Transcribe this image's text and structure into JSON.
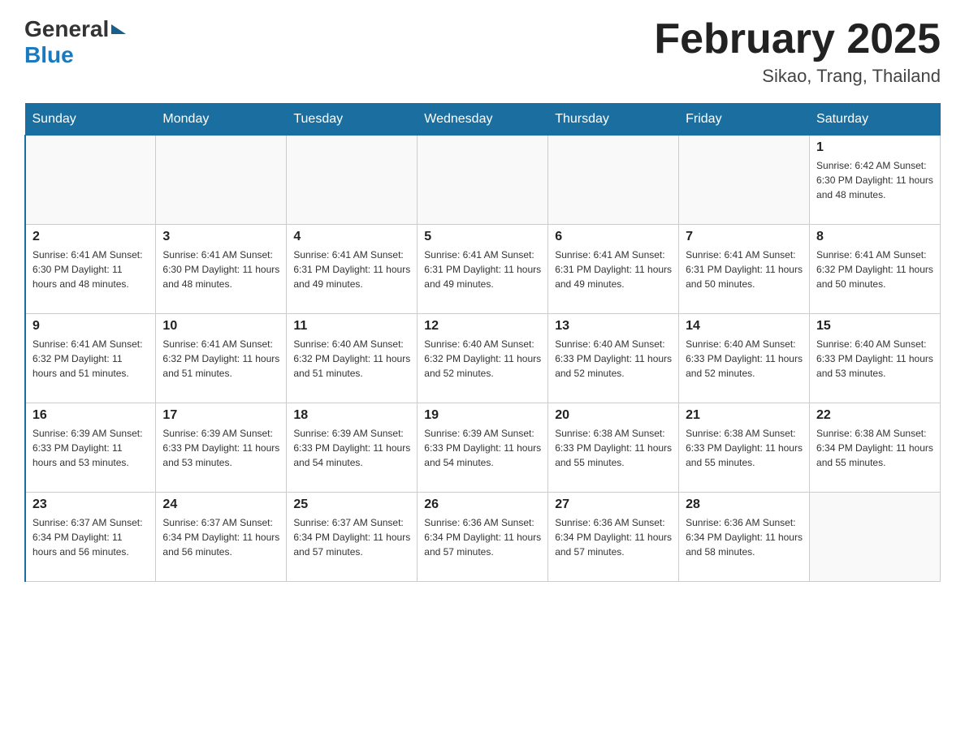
{
  "header": {
    "month_title": "February 2025",
    "location": "Sikao, Trang, Thailand",
    "logo_general": "General",
    "logo_blue": "Blue"
  },
  "days_of_week": [
    "Sunday",
    "Monday",
    "Tuesday",
    "Wednesday",
    "Thursday",
    "Friday",
    "Saturday"
  ],
  "weeks": [
    [
      {
        "day": "",
        "info": ""
      },
      {
        "day": "",
        "info": ""
      },
      {
        "day": "",
        "info": ""
      },
      {
        "day": "",
        "info": ""
      },
      {
        "day": "",
        "info": ""
      },
      {
        "day": "",
        "info": ""
      },
      {
        "day": "1",
        "info": "Sunrise: 6:42 AM\nSunset: 6:30 PM\nDaylight: 11 hours\nand 48 minutes."
      }
    ],
    [
      {
        "day": "2",
        "info": "Sunrise: 6:41 AM\nSunset: 6:30 PM\nDaylight: 11 hours\nand 48 minutes."
      },
      {
        "day": "3",
        "info": "Sunrise: 6:41 AM\nSunset: 6:30 PM\nDaylight: 11 hours\nand 48 minutes."
      },
      {
        "day": "4",
        "info": "Sunrise: 6:41 AM\nSunset: 6:31 PM\nDaylight: 11 hours\nand 49 minutes."
      },
      {
        "day": "5",
        "info": "Sunrise: 6:41 AM\nSunset: 6:31 PM\nDaylight: 11 hours\nand 49 minutes."
      },
      {
        "day": "6",
        "info": "Sunrise: 6:41 AM\nSunset: 6:31 PM\nDaylight: 11 hours\nand 49 minutes."
      },
      {
        "day": "7",
        "info": "Sunrise: 6:41 AM\nSunset: 6:31 PM\nDaylight: 11 hours\nand 50 minutes."
      },
      {
        "day": "8",
        "info": "Sunrise: 6:41 AM\nSunset: 6:32 PM\nDaylight: 11 hours\nand 50 minutes."
      }
    ],
    [
      {
        "day": "9",
        "info": "Sunrise: 6:41 AM\nSunset: 6:32 PM\nDaylight: 11 hours\nand 51 minutes."
      },
      {
        "day": "10",
        "info": "Sunrise: 6:41 AM\nSunset: 6:32 PM\nDaylight: 11 hours\nand 51 minutes."
      },
      {
        "day": "11",
        "info": "Sunrise: 6:40 AM\nSunset: 6:32 PM\nDaylight: 11 hours\nand 51 minutes."
      },
      {
        "day": "12",
        "info": "Sunrise: 6:40 AM\nSunset: 6:32 PM\nDaylight: 11 hours\nand 52 minutes."
      },
      {
        "day": "13",
        "info": "Sunrise: 6:40 AM\nSunset: 6:33 PM\nDaylight: 11 hours\nand 52 minutes."
      },
      {
        "day": "14",
        "info": "Sunrise: 6:40 AM\nSunset: 6:33 PM\nDaylight: 11 hours\nand 52 minutes."
      },
      {
        "day": "15",
        "info": "Sunrise: 6:40 AM\nSunset: 6:33 PM\nDaylight: 11 hours\nand 53 minutes."
      }
    ],
    [
      {
        "day": "16",
        "info": "Sunrise: 6:39 AM\nSunset: 6:33 PM\nDaylight: 11 hours\nand 53 minutes."
      },
      {
        "day": "17",
        "info": "Sunrise: 6:39 AM\nSunset: 6:33 PM\nDaylight: 11 hours\nand 53 minutes."
      },
      {
        "day": "18",
        "info": "Sunrise: 6:39 AM\nSunset: 6:33 PM\nDaylight: 11 hours\nand 54 minutes."
      },
      {
        "day": "19",
        "info": "Sunrise: 6:39 AM\nSunset: 6:33 PM\nDaylight: 11 hours\nand 54 minutes."
      },
      {
        "day": "20",
        "info": "Sunrise: 6:38 AM\nSunset: 6:33 PM\nDaylight: 11 hours\nand 55 minutes."
      },
      {
        "day": "21",
        "info": "Sunrise: 6:38 AM\nSunset: 6:33 PM\nDaylight: 11 hours\nand 55 minutes."
      },
      {
        "day": "22",
        "info": "Sunrise: 6:38 AM\nSunset: 6:34 PM\nDaylight: 11 hours\nand 55 minutes."
      }
    ],
    [
      {
        "day": "23",
        "info": "Sunrise: 6:37 AM\nSunset: 6:34 PM\nDaylight: 11 hours\nand 56 minutes."
      },
      {
        "day": "24",
        "info": "Sunrise: 6:37 AM\nSunset: 6:34 PM\nDaylight: 11 hours\nand 56 minutes."
      },
      {
        "day": "25",
        "info": "Sunrise: 6:37 AM\nSunset: 6:34 PM\nDaylight: 11 hours\nand 57 minutes."
      },
      {
        "day": "26",
        "info": "Sunrise: 6:36 AM\nSunset: 6:34 PM\nDaylight: 11 hours\nand 57 minutes."
      },
      {
        "day": "27",
        "info": "Sunrise: 6:36 AM\nSunset: 6:34 PM\nDaylight: 11 hours\nand 57 minutes."
      },
      {
        "day": "28",
        "info": "Sunrise: 6:36 AM\nSunset: 6:34 PM\nDaylight: 11 hours\nand 58 minutes."
      },
      {
        "day": "",
        "info": ""
      }
    ]
  ],
  "accent_color": "#1a6fa0"
}
